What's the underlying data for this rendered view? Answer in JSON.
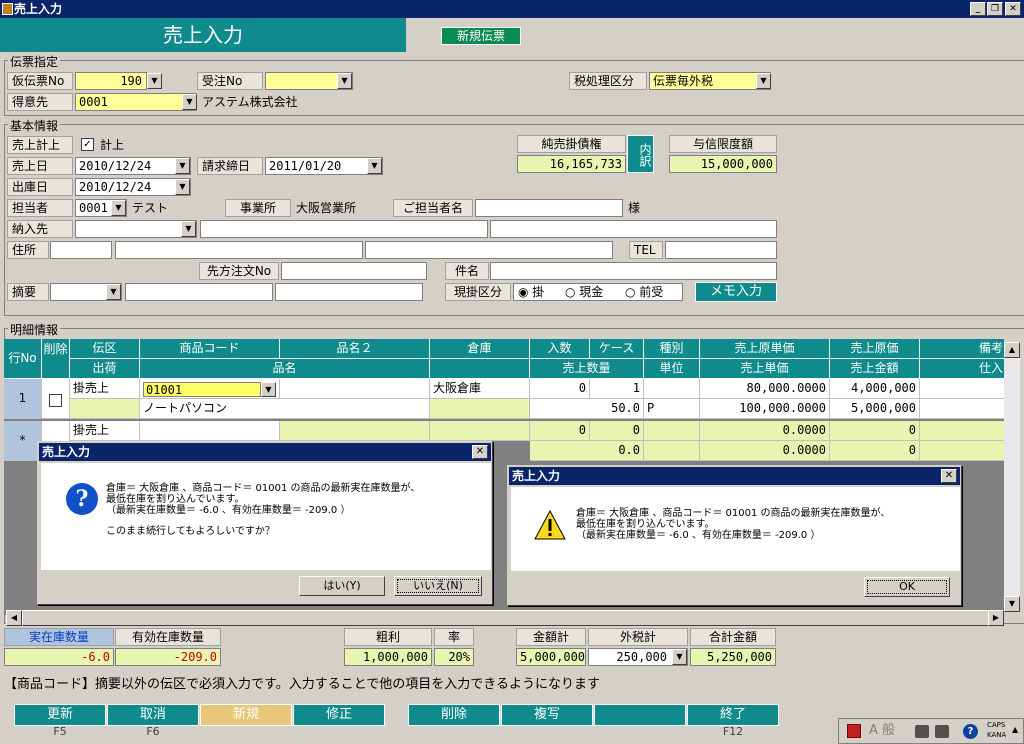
{
  "window": {
    "title": "売上入力"
  },
  "header": {
    "title": "売上入力",
    "new_slip": "新規伝票"
  },
  "denpyo": {
    "group": "伝票指定",
    "karidenpyo_label": "仮伝票No",
    "karidenpyo_value": "190",
    "juchu_label": "受注No",
    "zei_label": "税処理区分",
    "zei_value": "伝票毎外税",
    "tokui_label": "得意先",
    "tokui_code": "0001",
    "tokui_name": "アステム株式会社"
  },
  "kihon": {
    "group": "基本情報",
    "keijo_label": "売上計上",
    "keijo_value": "計上",
    "uriagebi_label": "売上日",
    "uriagebi": "2010/12/24",
    "seikyu_label": "請求締日",
    "seikyu": "2011/01/20",
    "shukko_label": "出庫日",
    "shukko": "2010/12/24",
    "tanto_label": "担当者",
    "tanto_code": "0001",
    "tanto_name": "テスト",
    "jigyosho_label": "事業所",
    "jigyosho": "大阪営業所",
    "gotanto_label": "ご担当者名",
    "sama": "様",
    "nonyu_label": "納入先",
    "jusho_label": "住所",
    "tel_label": "TEL",
    "sakichu_label": "先方注文No",
    "kenmei_label": "件名",
    "tekiyo_label": "摘要",
    "genkake_label": "現掛区分",
    "kake": "掛",
    "genkin": "現金",
    "maeuke": "前受",
    "memo": "メモ入力",
    "junuri_label": "純売掛債権",
    "junuri": "16,165,733",
    "uchiwake": "内訳",
    "yoshin_label": "与信限度額",
    "yoshin": "15,000,000"
  },
  "meisai": {
    "group": "明細情報",
    "h_row": "行No",
    "h_del": "削除",
    "h_den": "伝区",
    "h_code": "商品コード",
    "h_hin2": "品名２",
    "h_soko": "倉庫",
    "h_iri": "入数",
    "h_case": "ケース",
    "h_shu": "種別",
    "h_genka_tanka": "売上原単価",
    "h_genka": "売上原価",
    "h_biko": "備考",
    "h_shuka": "出荷",
    "h_hinmei": "品名",
    "h_suryo": "売上数量",
    "h_tani": "単位",
    "h_tanka": "売上単価",
    "h_kingaku": "売上金額",
    "h_shire": "仕入",
    "rows": [
      {
        "no": "1",
        "den": "掛売上",
        "code": "01001",
        "soko": "大阪倉庫",
        "iri": "0",
        "case": "1",
        "genka_tanka": "80,000.0000",
        "genka": "4,000,000",
        "hinmei": "ノートパソコン",
        "suryo": "50.0",
        "tani": "P",
        "tanka": "100,000.0000",
        "kingaku": "5,000,000"
      },
      {
        "no": "*",
        "den": "掛売上",
        "iri": "0",
        "case": "0",
        "genka_tanka": "0.0000",
        "genka": "0",
        "suryo": "0.0",
        "tanka": "0.0000",
        "kingaku": "0"
      }
    ]
  },
  "totals": {
    "jitsu_label": "実在庫数量",
    "jitsu": "-6.0",
    "yuko_label": "有効在庫数量",
    "yuko": "-209.0",
    "arari_label": "粗利",
    "arari": "1,000,000",
    "ritsu_label": "率",
    "ritsu": "20%",
    "kingaku_label": "金額計",
    "kingaku": "5,000,000",
    "sotozei_label": "外税計",
    "sotozei": "250,000",
    "gokei_label": "合計金額",
    "gokei": "5,250,000"
  },
  "status": "【商品コード】摘要以外の伝区で必須入力です。入力することで他の項目を入力できるようになります",
  "fkeys": [
    {
      "label": "更新",
      "key": "F5"
    },
    {
      "label": "取消",
      "key": "F6"
    },
    {
      "label": "新規",
      "key": ""
    },
    {
      "label": "修正",
      "key": ""
    },
    {
      "label": "",
      "key": ""
    },
    {
      "label": "削除",
      "key": ""
    },
    {
      "label": "複写",
      "key": ""
    },
    {
      "label": "",
      "key": ""
    },
    {
      "label": "終了",
      "key": "F12"
    }
  ],
  "dialog1": {
    "title": "売上入力",
    "line1": "倉庫＝ 大阪倉庫 、商品コード＝ 01001 の商品の最新実在庫数量が、",
    "line2": "最低在庫を割り込んでいます。",
    "line3": "（最新実在庫数量＝ -6.0 、有効在庫数量＝ -209.0 ）",
    "line4": "このまま続行してもよろしいですか？",
    "yes": "はい(Y)",
    "no": "いいえ(N)"
  },
  "dialog2": {
    "title": "売上入力",
    "line1": "倉庫＝ 大阪倉庫 、商品コード＝ 01001 の商品の最新実在庫数量が、",
    "line2": "最低在庫を割り込んでいます。",
    "line3": "（最新実在庫数量＝ -6.0 、有効在庫数量＝ -209.0 ）",
    "ok": "OK"
  },
  "tray": {
    "ime": "A 般",
    "caps": "CAPS",
    "kana": "KANA"
  }
}
